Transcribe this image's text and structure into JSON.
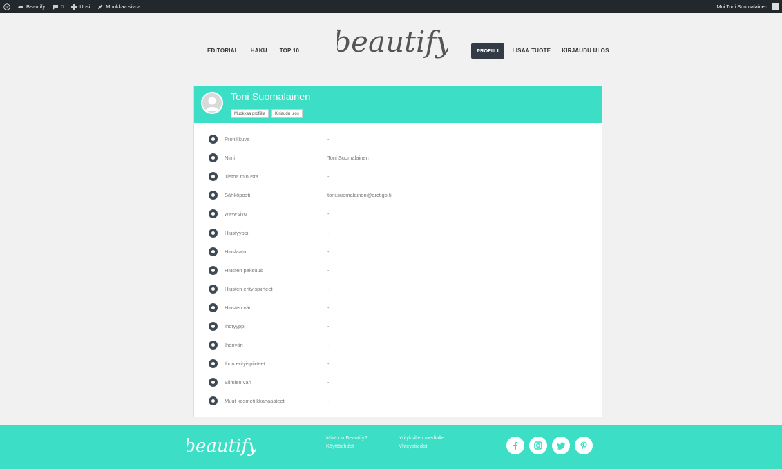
{
  "adminbar": {
    "site_name": "Beautify",
    "comments_count": "0",
    "new_label": "Uusi",
    "edit_label": "Muokkaa sivua",
    "greeting": "Moi Toni Suomalainen"
  },
  "header": {
    "nav_left": [
      "EDITORIAL",
      "HAKU",
      "TOP 10"
    ],
    "logo_text": "beautify",
    "nav_right": {
      "active": "PROFIILI",
      "add_product": "LISÄÄ TUOTE",
      "logout": "KIRJAUDU ULOS"
    }
  },
  "profile": {
    "name": "Toni Suomalainen",
    "edit_button": "Muokkaa profiilia",
    "logout_button": "Kirjaudu ulos",
    "fields": [
      {
        "label": "Profiilikuva",
        "value": "-",
        "icon": "camera-icon"
      },
      {
        "label": "Nimi",
        "value": "Toni Suomalainen",
        "icon": "user-icon"
      },
      {
        "label": "Tietoa minusta",
        "value": "-",
        "icon": "pencil-icon"
      },
      {
        "label": "Sähköposti",
        "value": "toni.suomalainen@arctigo.fi",
        "icon": "envelope-icon"
      },
      {
        "label": "www-sivu",
        "value": "-",
        "icon": "link-icon"
      },
      {
        "label": "Hiustyyppi",
        "value": "-",
        "icon": "circle-icon"
      },
      {
        "label": "Hiuslaatu",
        "value": "-",
        "icon": "circle-icon"
      },
      {
        "label": "Hiusten paksuus",
        "value": "-",
        "icon": "circle-icon"
      },
      {
        "label": "Hiusten erityispiirteet",
        "value": "-",
        "icon": "circle-icon"
      },
      {
        "label": "Hiusten väri",
        "value": "-",
        "icon": "circle-icon"
      },
      {
        "label": "Ihotyyppi",
        "value": "-",
        "icon": "circle-icon"
      },
      {
        "label": "Ihonväri",
        "value": "-",
        "icon": "circle-icon"
      },
      {
        "label": "Ihon erityispiirteet",
        "value": "-",
        "icon": "circle-icon"
      },
      {
        "label": "Silmien väri",
        "value": "-",
        "icon": "circle-icon"
      },
      {
        "label": "Muut kosmetiikkahaasteet",
        "value": "-",
        "icon": "circle-icon"
      }
    ]
  },
  "footer": {
    "logo_text": "beautify",
    "links_col1": [
      "Mikä on Beautify?",
      "Käyttöehdot"
    ],
    "links_col2": [
      "Yrityksille / medialle",
      "Yhteystiedot"
    ],
    "socials": [
      "facebook-icon",
      "instagram-icon",
      "twitter-icon",
      "pinterest-icon"
    ]
  },
  "colors": {
    "accent": "#3cdec5",
    "admin_bar": "#23282d",
    "nav_active": "#333c45"
  }
}
